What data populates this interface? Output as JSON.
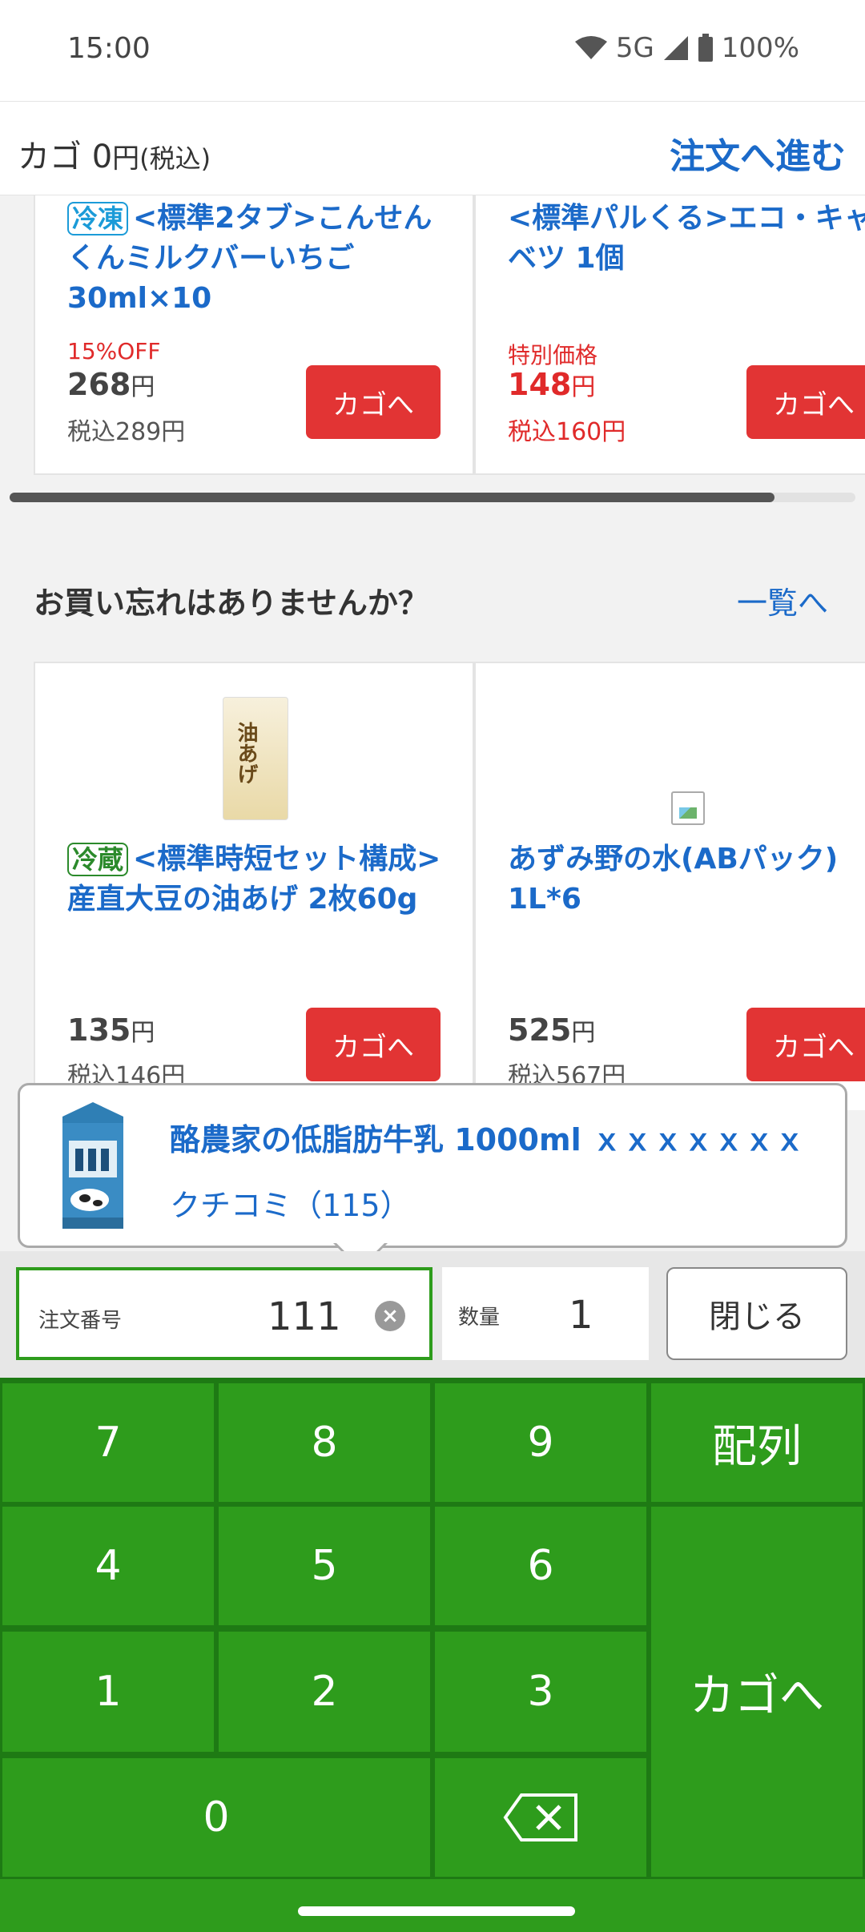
{
  "status_bar": {
    "time": "15:00",
    "network": "5G",
    "battery": "100%"
  },
  "cart_header": {
    "label": "カゴ",
    "count": "0",
    "yen": "円",
    "tax": "(税込)",
    "order_link": "注文へ進む"
  },
  "recommend_products": [
    {
      "tag": "冷凍",
      "name": "<標準2タブ>こんせんくんミルクバーいちご30ml×10",
      "promo": "15%OFF",
      "price": "268",
      "price_unit": "円",
      "tax_price": "税込289円",
      "button": "カゴへ"
    },
    {
      "tag": "",
      "name": "<標準パルくる>エコ・キャベツ 1個",
      "promo": "特別価格",
      "price": "148",
      "price_unit": "円",
      "tax_price": "税込160円",
      "button": "カゴへ"
    }
  ],
  "forgot_section": {
    "title": "お買い忘れはありませんか？",
    "see_all": "一覧へ"
  },
  "forgot_products": [
    {
      "tag": "冷蔵",
      "name": "<標準時短セット構成>産直大豆の油あげ 2枚60g",
      "image_text": "油あげ",
      "price": "135",
      "price_unit": "円",
      "tax_price": "税込146円",
      "button": "カゴへ"
    },
    {
      "tag": "",
      "name": "あずみ野の水(ABパック) 1L*6",
      "price": "525",
      "price_unit": "円",
      "tax_price": "税込567円",
      "button": "カゴへ"
    }
  ],
  "popup": {
    "title": "酪農家の低脂肪牛乳 1000ml ｘｘｘｘｘｘｘ",
    "review": "クチコミ（115）"
  },
  "input_bar": {
    "order_label": "注文番号",
    "order_value": "111",
    "qty_label": "数量",
    "qty_value": "1",
    "close": "閉じる"
  },
  "keypad": {
    "k7": "7",
    "k8": "8",
    "k9": "9",
    "k4": "4",
    "k5": "5",
    "k6": "6",
    "k1": "1",
    "k2": "2",
    "k3": "3",
    "k0": "0",
    "layout": "配列",
    "add_cart": "カゴへ"
  },
  "colors": {
    "accent_blue": "#1b6ac9",
    "sale_red": "#e02a2a",
    "button_red": "#e23434",
    "keypad_green": "#2e9c1c"
  }
}
